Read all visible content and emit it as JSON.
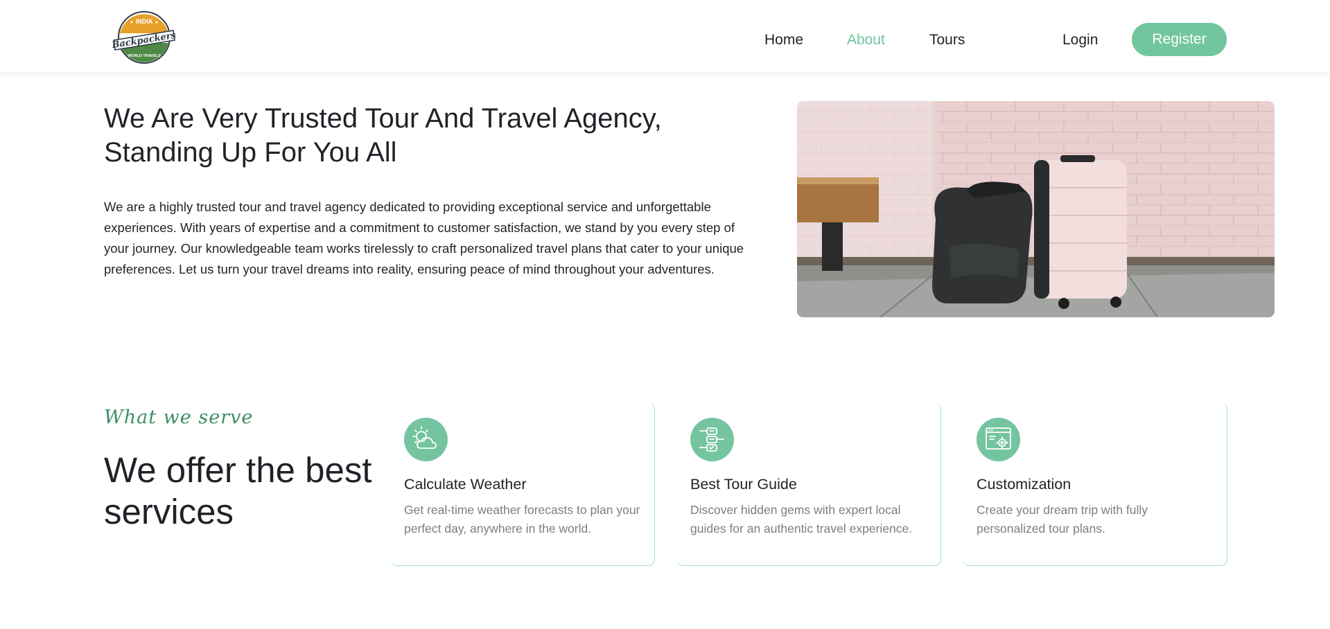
{
  "brand": {
    "logo_top_text": "INDIA",
    "logo_main_text": "Backpackers",
    "logo_bottom_text": "WORLD TRAVELS"
  },
  "nav": {
    "items": [
      {
        "label": "Home"
      },
      {
        "label": "About",
        "active": true
      },
      {
        "label": "Tours"
      }
    ],
    "login_label": "Login",
    "register_label": "Register"
  },
  "hero": {
    "title": "We Are Very Trusted Tour And Travel Agency, Standing Up For You All",
    "text": "We are a highly trusted tour and travel agency dedicated to providing exceptional service and unforgettable experiences. With years of expertise and a commitment to customer satisfaction, we stand by you every step of your journey. Our knowledgeable team works tirelessly to craft personalized travel plans that cater to your unique preferences. Let us turn your travel dreams into reality, ensuring peace of mind throughout your adventures."
  },
  "services": {
    "subtitle": "What we serve",
    "heading": "We offer the best services",
    "cards": [
      {
        "icon": "weather-icon",
        "title": "Calculate Weather",
        "text": "Get real-time weather forecasts to plan your perfect day, anywhere in the world."
      },
      {
        "icon": "guide-icon",
        "title": "Best Tour Guide",
        "text": "Discover hidden gems with expert local guides for an authentic travel experience."
      },
      {
        "icon": "customization-icon",
        "title": "Customization",
        "text": "Create your dream trip with fully personalized tour plans."
      }
    ]
  },
  "colors": {
    "accent": "#72c69d",
    "subtitle": "#3c8d63",
    "card_border": "#9fdccf",
    "muted_text": "#7a7e83"
  }
}
